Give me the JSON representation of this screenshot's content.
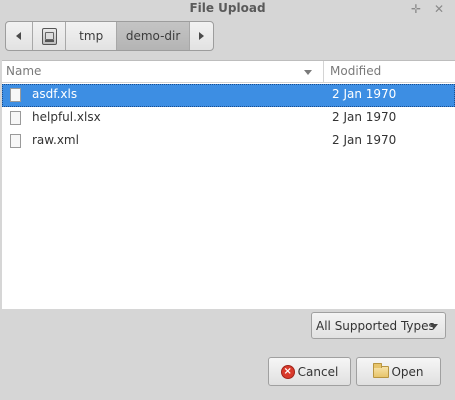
{
  "window": {
    "title": "File Upload",
    "move_glyph": "✛",
    "close_glyph": "✕"
  },
  "pathbar": {
    "segments": [
      "tmp",
      "demo-dir"
    ]
  },
  "columns": {
    "name": "Name",
    "modified": "Modified"
  },
  "files": [
    {
      "name": "asdf.xls",
      "modified": "2 Jan 1970",
      "selected": true
    },
    {
      "name": "helpful.xlsx",
      "modified": "2 Jan 1970",
      "selected": false
    },
    {
      "name": "raw.xml",
      "modified": "2 Jan 1970",
      "selected": false
    }
  ],
  "filter": {
    "selected": "All Supported Types"
  },
  "buttons": {
    "cancel": "Cancel",
    "open": "Open"
  },
  "colors": {
    "selection": "#3d8ee3",
    "cancel_icon": "#d93a2b"
  },
  "icons": {
    "drive": "drive-icon",
    "file": "file-icon",
    "cancel": "cancel-icon",
    "open": "folder-icon"
  }
}
